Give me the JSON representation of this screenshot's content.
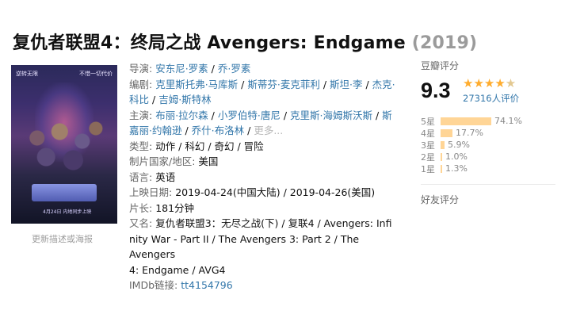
{
  "title": {
    "main": "复仇者联盟4：终局之战 Avengers: Endgame",
    "year": "(2019)"
  },
  "poster": {
    "tagline_left": "逆转无限",
    "tagline_right": "不惜一切代价",
    "date": "4月24日 内地同步上映",
    "caption": "更新描述或海报"
  },
  "info": {
    "director": {
      "label": "导演:",
      "names": [
        "安东尼·罗素",
        "乔·罗素"
      ]
    },
    "writer": {
      "label": "编剧:",
      "names": [
        "克里斯托弗·马库斯",
        "斯蒂芬·麦克菲利",
        "斯坦·李",
        "杰克·科比",
        "吉姆·斯特林"
      ]
    },
    "cast": {
      "label": "主演:",
      "names": [
        "布丽·拉尔森",
        "小罗伯特·唐尼",
        "克里斯·海姆斯沃斯",
        "斯嘉丽·约翰逊",
        "乔什·布洛林"
      ],
      "more": "更多..."
    },
    "genre": {
      "label": "类型:",
      "value": "动作 / 科幻 / 奇幻 / 冒险"
    },
    "country": {
      "label": "制片国家/地区:",
      "value": "美国"
    },
    "language": {
      "label": "语言:",
      "value": "英语"
    },
    "release": {
      "label": "上映日期:",
      "value": "2019-04-24(中国大陆) / 2019-04-26(美国)"
    },
    "runtime": {
      "label": "片长:",
      "value": "181分钟"
    },
    "aka": {
      "label": "又名:",
      "line1": "复仇者联盟3：无尽之战(下) / 复联4 / Avengers: Infi",
      "line2": "nity War - Part II / The Avengers 3: Part 2 / The Avengers",
      "line3": "4: Endgame / AVG4"
    },
    "imdb": {
      "label": "IMDb链接:",
      "value": "tt4154796"
    }
  },
  "rating": {
    "header": "豆瓣评分",
    "score": "9.3",
    "stars_value": 4.5,
    "count": "27316人评价",
    "breakdown": [
      {
        "label": "5星",
        "percent": "74.1%",
        "value": 74.1
      },
      {
        "label": "4星",
        "percent": "17.7%",
        "value": 17.7
      },
      {
        "label": "3星",
        "percent": "5.9%",
        "value": 5.9
      },
      {
        "label": "2星",
        "percent": "1.0%",
        "value": 1.0
      },
      {
        "label": "1星",
        "percent": "1.3%",
        "value": 1.3
      }
    ],
    "friends": "好友评分",
    "colors": {
      "star": "#ffac2d",
      "bar": "#ffd596",
      "link": "#3377aa"
    }
  }
}
